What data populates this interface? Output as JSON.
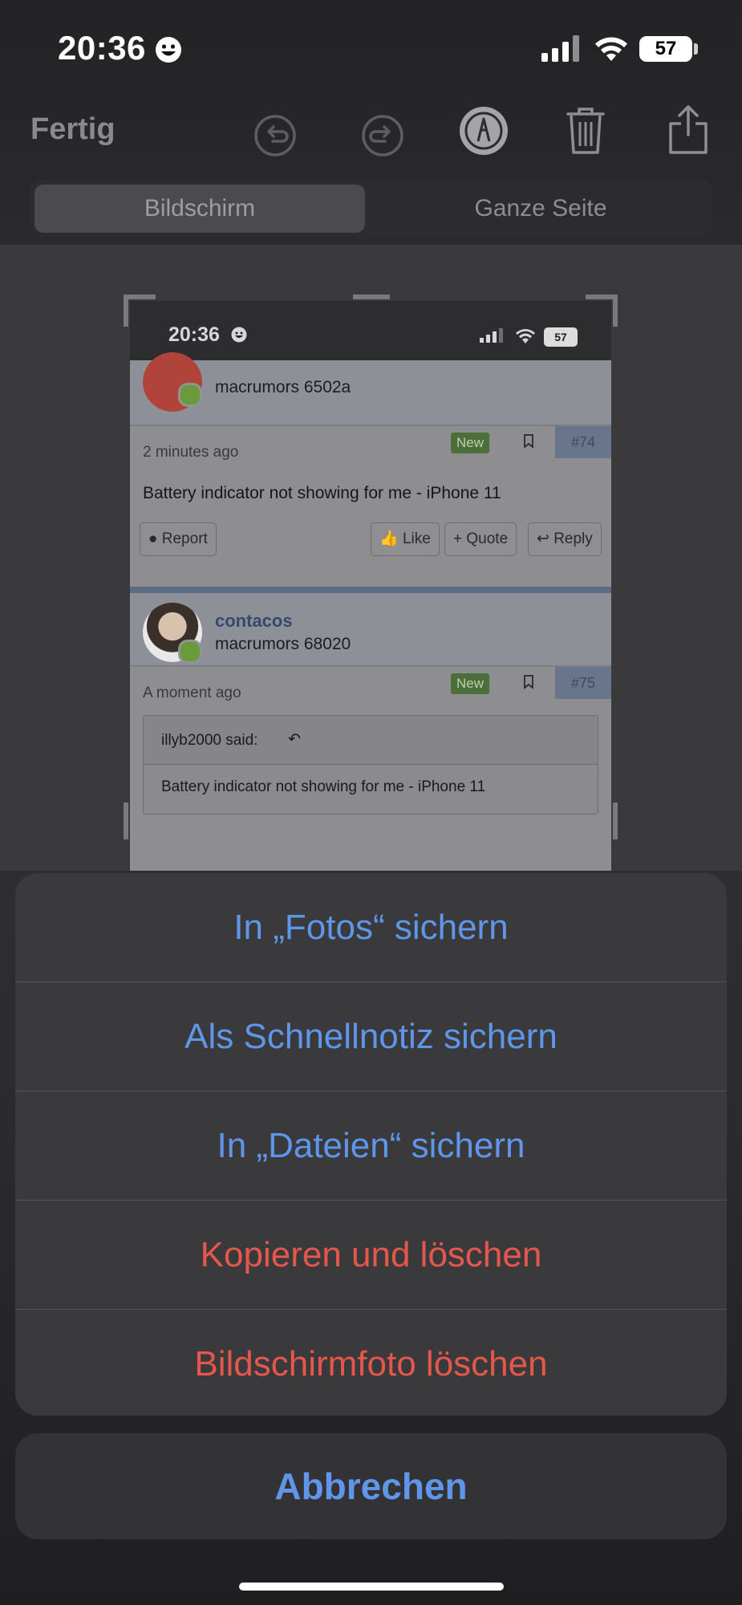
{
  "status_bar": {
    "time": "20:36",
    "battery": "57",
    "emoji_icon": "smiley-face-icon",
    "signal_icon": "cellular-signal-icon",
    "wifi_icon": "wifi-icon"
  },
  "toolbar": {
    "done_label": "Fertig",
    "icons": [
      "undo-icon",
      "redo-icon",
      "markup-pen-icon",
      "trash-icon",
      "share-icon"
    ]
  },
  "segmented": {
    "options": [
      "Bildschirm",
      "Ganze Seite"
    ],
    "selected": "Bildschirm"
  },
  "preview": {
    "status_time": "20:36",
    "status_battery": "57",
    "post1": {
      "user_title": "macrumors 6502a",
      "time": "2 minutes ago",
      "badge": "New",
      "number": "#74",
      "text": "Battery indicator not showing for me - iPhone 11",
      "buttons": {
        "report": "Report",
        "like": "Like",
        "quote": "+ Quote",
        "reply": "Reply"
      }
    },
    "post2": {
      "username": "contacos",
      "user_title": "macrumors 68020",
      "time": "A moment ago",
      "badge": "New",
      "number": "#75",
      "quote_author": "illyb2000 said:",
      "quote_text": "Battery indicator not showing for me - iPhone 11"
    }
  },
  "action_sheet": {
    "items": [
      {
        "label": "In „Fotos“ sichern",
        "style": "default"
      },
      {
        "label": "Als Schnellnotiz sichern",
        "style": "default"
      },
      {
        "label": "In „Dateien“ sichern",
        "style": "default"
      },
      {
        "label": "Kopieren und löschen",
        "style": "destructive"
      },
      {
        "label": "Bildschirmfoto löschen",
        "style": "destructive"
      }
    ],
    "cancel_label": "Abbrechen"
  },
  "colors": {
    "accent_blue": "#5f96ea",
    "destructive_red": "#e6574b",
    "sheet_background": "#3a3a3c"
  }
}
